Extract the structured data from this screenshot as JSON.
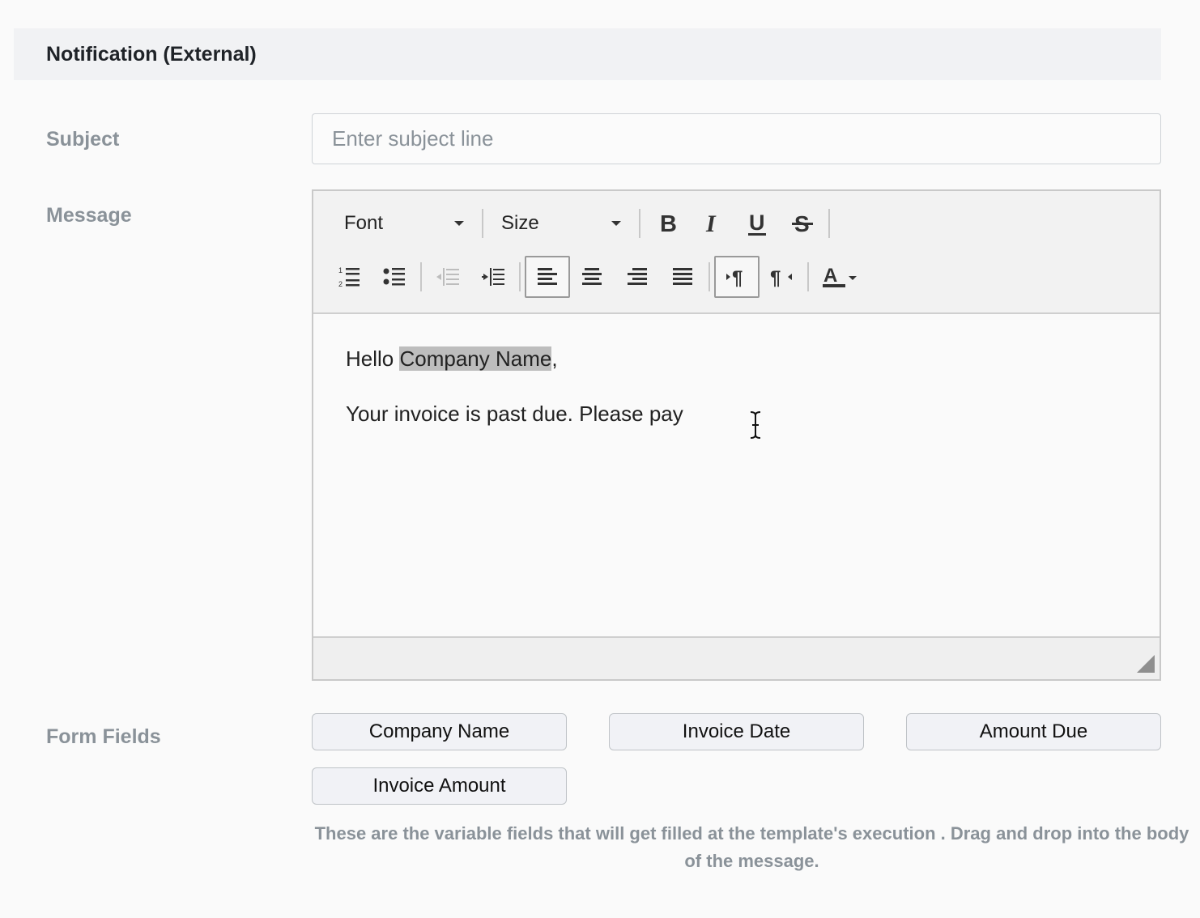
{
  "section": {
    "title": "Notification (External)"
  },
  "subject": {
    "label": "Subject",
    "placeholder": "Enter subject line",
    "value": ""
  },
  "message": {
    "label": "Message",
    "toolbar": {
      "font_label": "Font",
      "size_label": "Size",
      "buttons": [
        "bold",
        "italic",
        "underline",
        "strikethrough",
        "ordered-list",
        "unordered-list",
        "outdent",
        "indent",
        "align-left",
        "align-center",
        "align-right",
        "align-justify",
        "ltr",
        "rtl",
        "text-color"
      ],
      "active": [
        "align-left",
        "ltr"
      ]
    },
    "body": {
      "greeting_prefix": "Hello ",
      "greeting_field": "Company Name",
      "greeting_suffix": ",",
      "line2": "Your invoice is past due. Please pay"
    }
  },
  "form_fields": {
    "label": "Form Fields",
    "items": [
      "Company Name",
      "Invoice Date",
      "Amount Due",
      "Invoice Amount"
    ],
    "helper": "These are the variable fields that will get filled at the template's execution . Drag and drop into the body of the message."
  },
  "colors": {
    "header_bg": "#f1f2f4",
    "label": "#8a9299",
    "highlight": "#bdbdbd"
  }
}
